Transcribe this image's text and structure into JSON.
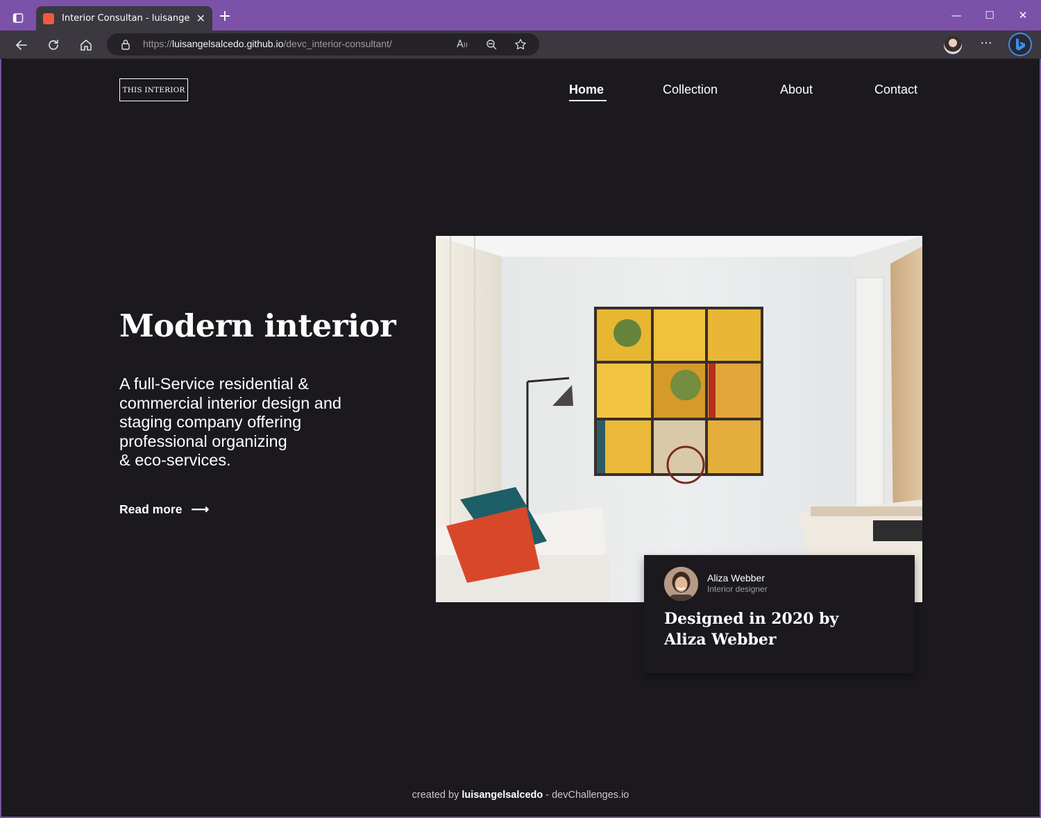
{
  "browser": {
    "tab_title": "Interior Consultan - luisangelsalc",
    "new_tab": "+",
    "url_prefix": "https://",
    "url_host": "luisangelsalcedo.github.io",
    "url_path": "/devc_interior-consultant/",
    "icons": [
      "tab-actions-icon",
      "favicon",
      "close-icon",
      "plus-icon",
      "minimize-icon",
      "maximize-icon",
      "window-close-icon",
      "back-icon",
      "refresh-icon",
      "home-icon",
      "lock-icon",
      "read-aloud-icon",
      "zoom-out-icon",
      "favorite-star-icon",
      "profile-avatar",
      "more-icon",
      "bing-icon"
    ]
  },
  "page": {
    "logo": "THIS INTERIOR",
    "nav": {
      "home": "Home",
      "collection": "Collection",
      "about": "About",
      "contact": "Contact"
    },
    "hero": {
      "title": "Modern interior",
      "description_lines": [
        "A full-Service residential &",
        "commercial interior design and",
        "staging company offering",
        "professional organizing",
        "& eco-services."
      ],
      "read_more": "Read more",
      "arrow": "⟶"
    },
    "card": {
      "name": "Aliza Webber",
      "role": "Interior designer",
      "title_line1": "Designed in 2020 by",
      "title_line2": "Aliza Webber"
    },
    "footer": {
      "prefix": "created by ",
      "author": "luisangelsalcedo",
      "suffix": " - devChallenges.io"
    }
  },
  "colors": {
    "chrome_title": "#7b52a8",
    "chrome_toolbar": "#3b3840",
    "page_bg": "#1b191d",
    "text": "#ffffff"
  }
}
